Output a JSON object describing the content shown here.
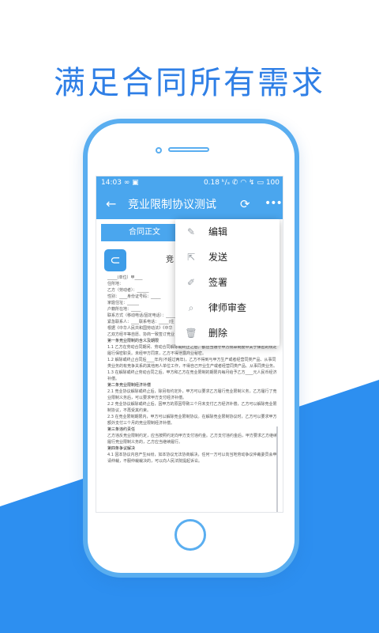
{
  "colors": {
    "accent": "#4aa6ee",
    "headline": "#2f7fe6",
    "band": "#2d8ff0"
  },
  "headline": "满足合同所有需求",
  "status_bar": {
    "time": "14:03",
    "left_icons": "∞ ▣",
    "right": "0.18 ᵏ/ₛ ✆ ◠ ↯ ▭ 100"
  },
  "app_bar": {
    "back_icon": "back-arrow-icon",
    "title": "竞业限制协议测试",
    "refresh_icon": "refresh-icon",
    "more_icon": "more-icon"
  },
  "tabs": {
    "active": "合同正文"
  },
  "document": {
    "title_fragment": "竞",
    "lines": [
      "_____(单位）甲____",
      "住所地：",
      "乙方（劳动者）：______",
      "性别：____身份证号码：_____",
      "家庭住址：______",
      "户籍所在地：_____",
      "联系方式（移动电话/固定电话）：_____(住",
      "紧急联系人：____联系电话：_____(住",
      "根据《中华人民共和国劳动法》《中华",
      "乙双方经平等自愿、协商一致签订竞业",
      "第一条竞业限制的含义及期限",
      "1.1 乙方在劳动合同期间、劳动合同解除或终止之后，都应当遵守甲方规章制度中关于保密的规定履行保密职责。未经甲方同意，乙方不得泄露商业秘密。",
      "1.2 解除或终止合同后____年内(不超过两年)，乙方不得到与甲方生产或者经营同类产品、从事同类业务的有竞争关系的其他用人单位工作，不得自己开业生产或者经营同类产品、从事同类业务。",
      "1.3 在解除或终止劳动合同之后，甲方和乙方在竞业限制的期限内每月给予乙方____元人民币经济补偿。",
      "第二条竞业限制经济补偿",
      "2.1 竞业协议解除或终止后，除另有约定外，甲方可以要求乙方履行竞业限制义务，乙方履行了竞业限制义务后，可以要求甲方支付经济补偿。",
      "2.2 竞业协议解除或终止后，因甲方的原因导致三个月未支付乙方经济补偿，乙方可以解除竞业限制协议，不再受其约束。",
      "2.3 在竞业限制期限内，甲方可以解除竞业限制协议。在解除竞业限制协议时，乙方可以要求甲方额外支付三个月的竞业限制经济补偿。",
      "第三条违约责任",
      "乙方违反竞业限制约定，应当按照约定向甲方支付违约金。乙方支付违约金后，甲方要求乙方继续履行竞业限制义务的，乙方应当继续履行。",
      "第四条争议解决",
      "4.1 因本协议内容产生纠纷，如本协议无法协商解决，任何一方可以向当地劳动争议仲裁委员会申请仲裁，不服仲裁裁决的，可以向人民法院提起诉讼。"
    ]
  },
  "menu": {
    "items": [
      {
        "label": "编辑",
        "icon": "edit-icon",
        "glyph": "✎"
      },
      {
        "label": "发送",
        "icon": "share-icon",
        "glyph": "⇱"
      },
      {
        "label": "签署",
        "icon": "pen-icon",
        "glyph": "✐"
      },
      {
        "label": "律师审查",
        "icon": "search-icon",
        "glyph": "⌕"
      },
      {
        "label": "删除",
        "icon": "trash-icon",
        "glyph": "🗑"
      }
    ]
  }
}
